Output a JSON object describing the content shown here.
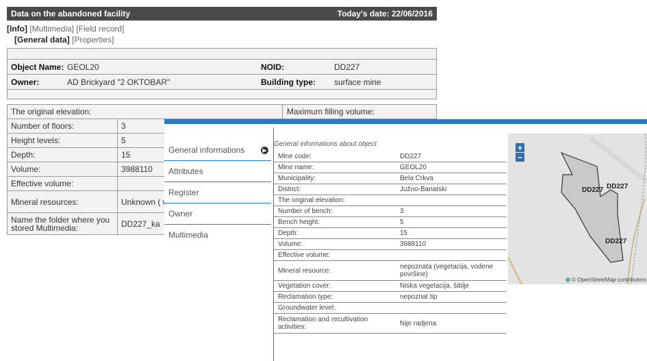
{
  "header": {
    "title": "Data on the abandoned facility",
    "date": "Today's date: 22/06/2016"
  },
  "nav": {
    "info": "[Info]",
    "multimedia": "[Multimedia]",
    "field_record": "[Field record]"
  },
  "subnav": {
    "general": "[General data]",
    "properties": "[Properties]"
  },
  "object": {
    "name_label": "Object Name:",
    "name_value": "GEOL20",
    "noid_label": "NOID:",
    "noid_value": "DD227",
    "owner_label": "Owner:",
    "owner_value": "AD Brickyard \"2 OKTOBAR\"",
    "type_label": "Building type:",
    "type_value": "surface mine"
  },
  "props": {
    "orig_elev": "The original elevation:",
    "max_fill": "Maximum filling volume:",
    "rows": [
      {
        "label": "Number of floors:",
        "value": "3"
      },
      {
        "label": "Height levels:",
        "value": "5"
      },
      {
        "label": "Depth:",
        "value": "15"
      },
      {
        "label": "Volume:",
        "value": "3988110"
      },
      {
        "label": "Effective volume:",
        "value": ""
      },
      {
        "label": "Mineral resources:",
        "value": "Unknown ( water)"
      },
      {
        "label": "Name the folder where you stored Multimedia:",
        "value": "DD227_ka"
      }
    ]
  },
  "menu": [
    "General informations",
    "Attributes",
    "Register",
    "Owner",
    "Multimedia"
  ],
  "info": {
    "title": "General informations about object",
    "rows": [
      {
        "label": "Mine code:",
        "value": "DD227"
      },
      {
        "label": "Mine name:",
        "value": "GEOL20"
      },
      {
        "label": "Municipality:",
        "value": "Bela Crkva"
      },
      {
        "label": "District:",
        "value": "Južno-Banatski"
      },
      {
        "label": "The original elevation:",
        "value": ""
      },
      {
        "label": "Number of bench:",
        "value": "3"
      },
      {
        "label": "Bench height:",
        "value": "5"
      },
      {
        "label": "Depth:",
        "value": "15"
      },
      {
        "label": "Volume:",
        "value": "3988110"
      },
      {
        "label": "Effective volume:",
        "value": ""
      },
      {
        "label": "Mineral resource:",
        "value": "nepoznata (vegetacija, vodene površine)"
      },
      {
        "label": "Vegetation cover:",
        "value": "Niska vegetacija, šiblje"
      },
      {
        "label": "Reclamation type:",
        "value": "nepoznat tip"
      },
      {
        "label": "Groundwater level:",
        "value": ""
      },
      {
        "label": "Reclamation and recultivation activities:",
        "value": "Nije radjena"
      }
    ]
  },
  "map": {
    "zoom_in": "+",
    "zoom_out": "−",
    "labels": [
      "DD227",
      "DD227",
      "DD227"
    ],
    "attribution": "© OpenStreetMap contributors"
  },
  "colors": {
    "accent": "#2c7bbf",
    "titlebar": "#4a4a4a"
  }
}
